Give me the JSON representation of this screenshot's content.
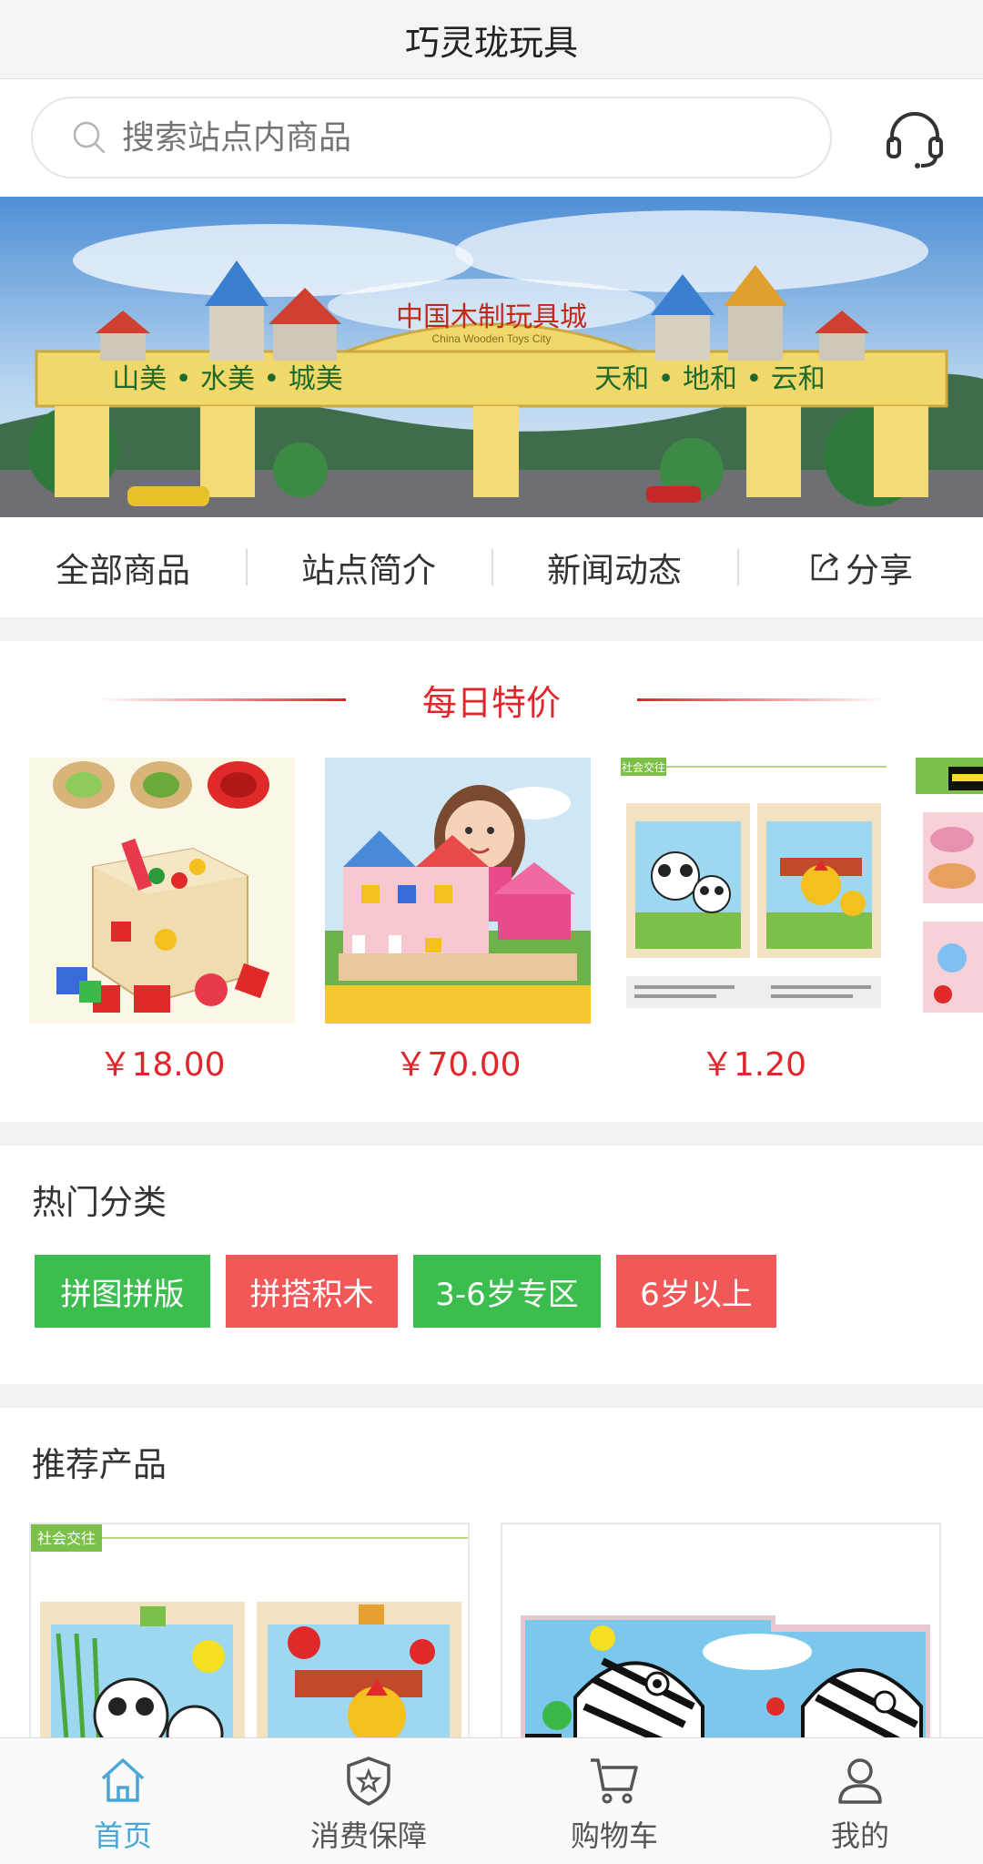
{
  "app": {
    "title": "巧灵珑玩具"
  },
  "search": {
    "placeholder": "搜索站点内商品",
    "icon": "search-icon",
    "service_icon": "headset-icon"
  },
  "banner": {
    "sign_text": "中国木制玩具城",
    "sign_sub": "China Wooden Toys City",
    "left_motto": "山美 • 水美 • 城美",
    "right_motto": "天和 • 地和 • 云和"
  },
  "nav": {
    "items": [
      {
        "label": "全部商品"
      },
      {
        "label": "站点简介"
      },
      {
        "label": "新闻动态"
      },
      {
        "label": "分享",
        "icon": "share-icon"
      }
    ]
  },
  "daily_deals": {
    "title": "每日特价",
    "accent": "#e0262a",
    "items": [
      {
        "price": "￥18.00",
        "image": "wooden-shape-sorter-cube"
      },
      {
        "price": "￥70.00",
        "image": "girl-with-building-blocks-farm"
      },
      {
        "price": "￥1.20",
        "image": "panda-rooster-puzzles",
        "tag": "社会交往"
      }
    ]
  },
  "hot_categories": {
    "title": "热门分类",
    "items": [
      {
        "label": "拼图拼版",
        "color": "#3cbe4e"
      },
      {
        "label": "拼搭积木",
        "color": "#f25858"
      },
      {
        "label": "3-6岁专区",
        "color": "#3cbe4e"
      },
      {
        "label": "6岁以上",
        "color": "#f25858"
      }
    ]
  },
  "recommended": {
    "title": "推荐产品",
    "items": [
      {
        "image": "panda-rooster-puzzles",
        "tag": "社会交往"
      },
      {
        "image": "zebra-puzzles"
      }
    ]
  },
  "tabbar": {
    "active_color": "#4aa6d6",
    "items": [
      {
        "label": "首页",
        "icon": "home-icon",
        "active": true
      },
      {
        "label": "消费保障",
        "icon": "shield-icon"
      },
      {
        "label": "购物车",
        "icon": "cart-icon"
      },
      {
        "label": "我的",
        "icon": "user-icon"
      }
    ]
  }
}
